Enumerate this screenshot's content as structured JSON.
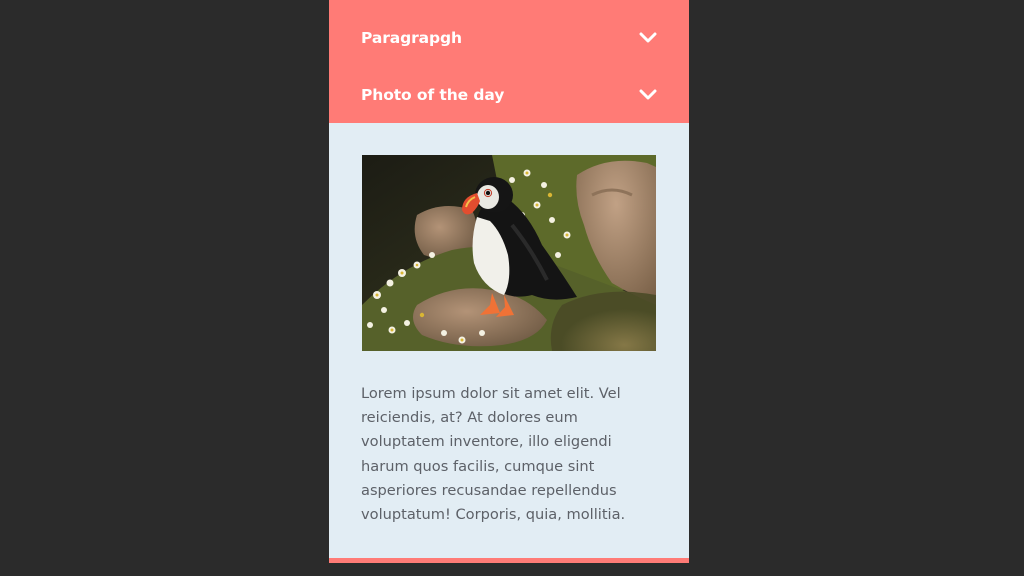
{
  "accordion": {
    "items": [
      {
        "label": "Paragrapgh",
        "icon": "chevron-down-icon"
      },
      {
        "label": "Photo of the day",
        "icon": "chevron-down-icon"
      }
    ]
  },
  "photo_of_the_day": {
    "description": "Lorem ipsum dolor sit amet elit. Vel reiciendis, at? At dolores eum voluptatem inventore, illo eligendi harum quos facilis, cumque sint asperiores recusandae repellendus voluptatum! Corporis, quia, mollitia."
  },
  "colors": {
    "accent": "#ff7b76",
    "panel_background": "#e2edf4",
    "page_background": "#2b2b2b",
    "text": "#5d6168"
  }
}
